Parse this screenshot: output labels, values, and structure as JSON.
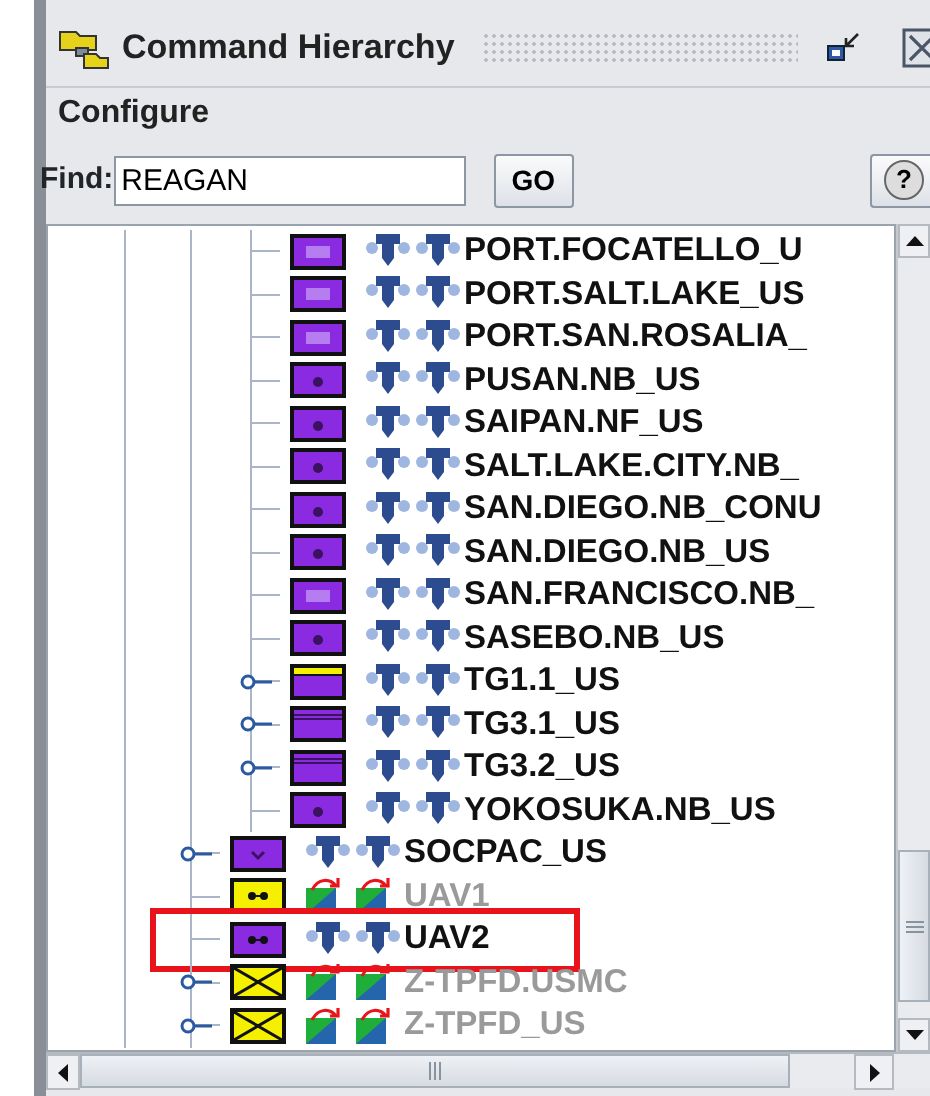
{
  "window": {
    "title": "Command Hierarchy"
  },
  "menu": [
    {
      "label": "Configure"
    }
  ],
  "find": {
    "label": "Find:",
    "value": "REAGAN",
    "button": "GO",
    "help": "?"
  },
  "tree": {
    "items": [
      {
        "children": [
          {
            "label": "PORT.FOCATELLO_U",
            "kind": "css",
            "active": true,
            "expandable": false,
            "highlighted": false
          },
          {
            "label": "PORT.SALT.LAKE_US",
            "kind": "css",
            "active": true,
            "expandable": false,
            "highlighted": false
          },
          {
            "label": "PORT.SAN.ROSALIA_",
            "kind": "css",
            "active": true,
            "expandable": false,
            "highlighted": false
          },
          {
            "label": "PUSAN.NB_US",
            "kind": "dot",
            "active": true,
            "expandable": false,
            "highlighted": false
          },
          {
            "label": "SAIPAN.NF_US",
            "kind": "dot",
            "active": true,
            "expandable": false,
            "highlighted": false
          },
          {
            "label": "SALT.LAKE.CITY.NB_",
            "kind": "dot",
            "active": true,
            "expandable": false,
            "highlighted": false
          },
          {
            "label": "SAN.DIEGO.NB_CONU",
            "kind": "dot",
            "active": true,
            "expandable": false,
            "highlighted": false
          },
          {
            "label": "SAN.DIEGO.NB_US",
            "kind": "dot",
            "active": true,
            "expandable": false,
            "highlighted": false
          },
          {
            "label": "SAN.FRANCISCO.NB_",
            "kind": "css",
            "active": true,
            "expandable": false,
            "highlighted": false
          },
          {
            "label": "SASEBO.NB_US",
            "kind": "dot",
            "active": true,
            "expandable": false,
            "highlighted": false
          },
          {
            "label": "TG1.1_US",
            "kind": "group-yellow",
            "active": true,
            "expandable": true,
            "highlighted": false
          },
          {
            "label": "TG3.1_US",
            "kind": "group",
            "active": true,
            "expandable": true,
            "highlighted": false
          },
          {
            "label": "TG3.2_US",
            "kind": "group",
            "active": true,
            "expandable": true,
            "highlighted": false
          },
          {
            "label": "YOKOSUKA.NB_US",
            "kind": "dot",
            "active": true,
            "expandable": false,
            "highlighted": false
          }
        ]
      },
      {
        "label": "SOCPAC_US",
        "kind": "sp",
        "active": true,
        "expandable": true,
        "highlighted": false
      },
      {
        "label": "UAV1",
        "kind": "uav-yellow",
        "active": false,
        "expandable": false,
        "highlighted": false
      },
      {
        "label": "UAV2",
        "kind": "uav-purple",
        "active": true,
        "expandable": false,
        "highlighted": true
      },
      {
        "label": "Z-TPFD.USMC",
        "kind": "cross-yellow",
        "active": false,
        "expandable": true,
        "highlighted": false
      },
      {
        "label": "Z-TPFD_US",
        "kind": "cross-yellow",
        "active": false,
        "expandable": true,
        "highlighted": false
      }
    ]
  }
}
